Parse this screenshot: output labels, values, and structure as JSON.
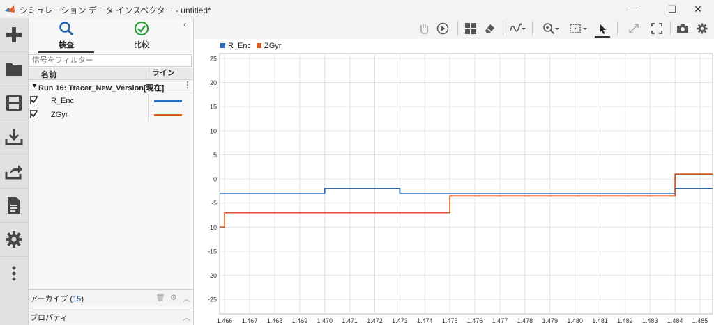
{
  "window": {
    "title": "シミュレーション データ インスペクター - untitled*",
    "minimize": "—",
    "maximize": "☐",
    "close": "✕"
  },
  "leftbar": {
    "items": [
      {
        "name": "new-icon"
      },
      {
        "name": "folder-open-icon"
      },
      {
        "name": "save-icon"
      },
      {
        "name": "import-icon"
      },
      {
        "name": "export-icon"
      },
      {
        "name": "report-icon"
      },
      {
        "name": "preferences-icon"
      },
      {
        "name": "more-icon"
      }
    ]
  },
  "panel": {
    "tab_inspect": "検査",
    "tab_compare": "比較",
    "filter_placeholder": "信号をフィルター",
    "col_name": "名前",
    "col_line": "ライン",
    "run_label": "Run 16: Tracer_New_Version[現在]",
    "signals": [
      {
        "name": "R_Enc",
        "checked": true,
        "color": "#2a6ebb"
      },
      {
        "name": "ZGyr",
        "checked": true,
        "color": "#d05a1e"
      }
    ],
    "archive_label": "アーカイブ (",
    "archive_count": "15",
    "archive_close": ")",
    "properties_label": "プロパティ"
  },
  "toolbar": {
    "icons": [
      "pan-hand-icon",
      "play-icon",
      "layout-icon",
      "eraser-icon",
      "signal-icon",
      "zoom-in-icon",
      "fit-icon",
      "cursor-icon",
      "expand-icon",
      "fullscreen-icon",
      "camera-icon",
      "gear-icon"
    ]
  },
  "chart_data": {
    "type": "line",
    "title": "",
    "xlabel": "",
    "ylabel": "",
    "xlim": [
      1.4658,
      1.4855
    ],
    "ylim": [
      -28,
      26
    ],
    "grid": true,
    "legend_placement": "top-left",
    "x_ticks": [
      "1.466",
      "1.467",
      "1.468",
      "1.469",
      "1.470",
      "1.471",
      "1.472",
      "1.473",
      "1.474",
      "1.475",
      "1.476",
      "1.477",
      "1.478",
      "1.479",
      "1.480",
      "1.481",
      "1.482",
      "1.483",
      "1.484",
      "1.485"
    ],
    "y_ticks": [
      "25",
      "20",
      "15",
      "10",
      "5",
      "0",
      "-5",
      "-10",
      "-15",
      "-20",
      "-25"
    ],
    "series": [
      {
        "name": "R_Enc",
        "color": "#2a6ebb",
        "step": true,
        "x": [
          1.4658,
          1.47,
          1.473,
          1.484,
          1.4855
        ],
        "y": [
          -3,
          -2,
          -3,
          -2,
          -2
        ]
      },
      {
        "name": "ZGyr",
        "color": "#d05a1e",
        "step": true,
        "x": [
          1.4658,
          1.466,
          1.475,
          1.484,
          1.4855
        ],
        "y": [
          -10,
          -7,
          -3.5,
          1,
          1
        ]
      }
    ]
  }
}
